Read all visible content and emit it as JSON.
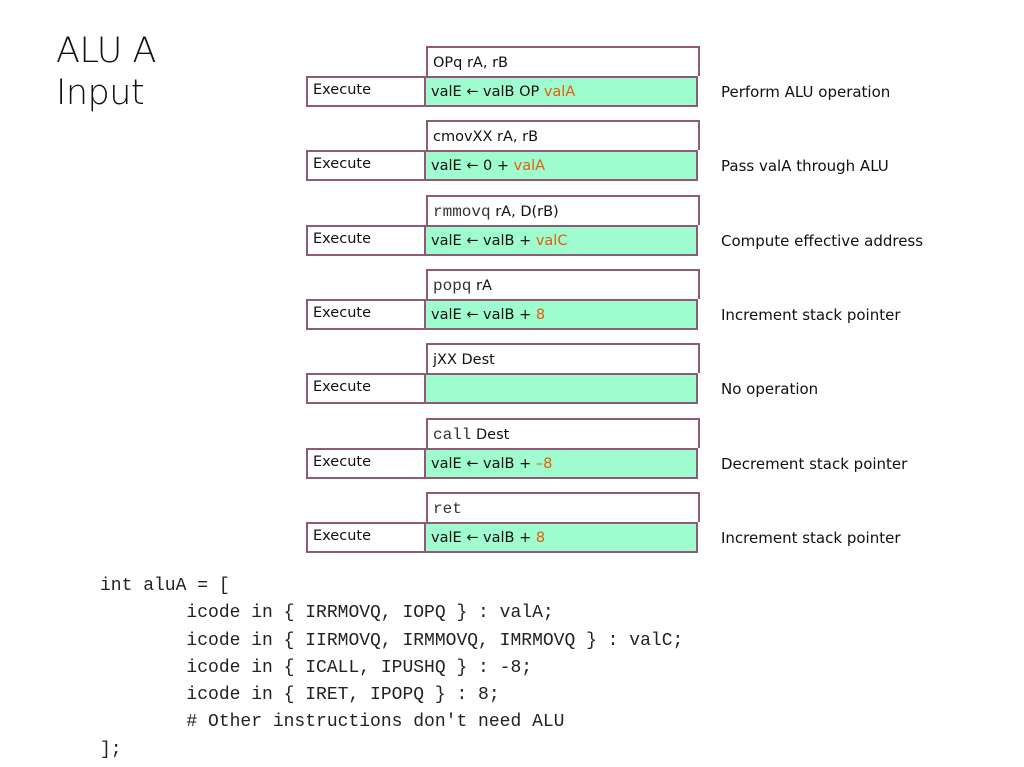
{
  "title": {
    "line1": "ALU A",
    "line2": "Input"
  },
  "colors": {
    "box_border": "#8e5a76",
    "execute_fill": "#9ffccf",
    "highlight": "#e35d0e"
  },
  "blocks": [
    {
      "instr_mono": "",
      "instr_text": "OPq rA, rB",
      "stage": "Execute",
      "op_prefix": "valE ← valB OP ",
      "op_highlight": "valA",
      "description": "Perform ALU operation"
    },
    {
      "instr_mono": "",
      "instr_text": "cmovXX rA, rB",
      "stage": "Execute",
      "op_prefix": "valE ← 0 + ",
      "op_highlight": "valA",
      "description": "Pass valA through ALU"
    },
    {
      "instr_mono": "rmmovq",
      "instr_text": " rA, D(rB)",
      "stage": "Execute",
      "op_prefix": "valE ← valB + ",
      "op_highlight": "valC",
      "description": "Compute effective address"
    },
    {
      "instr_mono": "popq",
      "instr_text": " rA",
      "stage": "Execute",
      "op_prefix": "valE ← valB + ",
      "op_highlight": "8",
      "description": "Increment stack pointer"
    },
    {
      "instr_mono": "",
      "instr_text": "jXX Dest",
      "stage": "Execute",
      "op_prefix": "",
      "op_highlight": "",
      "description": "No operation"
    },
    {
      "instr_mono": "call",
      "instr_text": " Dest",
      "stage": "Execute",
      "op_prefix": "valE ← valB + ",
      "op_highlight": "–8",
      "description": "Decrement stack pointer"
    },
    {
      "instr_mono": "ret",
      "instr_text": "",
      "stage": "Execute",
      "op_prefix": "valE ← valB + ",
      "op_highlight": "8",
      "description": "Increment stack pointer"
    }
  ],
  "code": [
    "int aluA = [",
    "        icode in { IRRMOVQ, IOPQ } : valA;",
    "        icode in { IIRMOVQ, IRMMOVQ, IMRMOVQ } : valC;",
    "        icode in { ICALL, IPUSHQ } : -8;",
    "        icode in { IRET, IPOPQ } : 8;",
    "        # Other instructions don't need ALU",
    "];"
  ]
}
